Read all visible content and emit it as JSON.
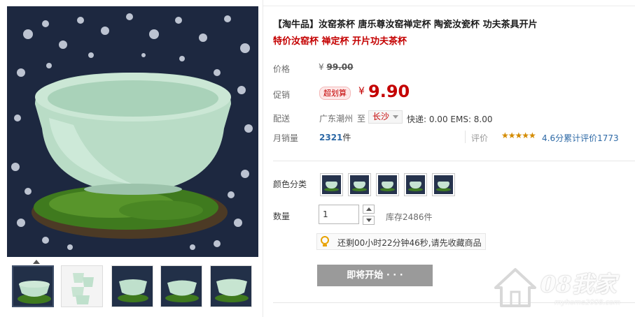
{
  "product": {
    "title": "【淘牛品】汝窑茶杯 唐乐尊汝窑禅定杯 陶瓷汝瓷杯 功夫茶具开片",
    "subtitle": "特价汝窑杯 禅定杯 开片功夫茶杯"
  },
  "price": {
    "label": "价格",
    "currency": "¥",
    "original": "99.00"
  },
  "promo": {
    "label": "促销",
    "badge": "超划算",
    "currency": "¥",
    "price": "9.90"
  },
  "shipping": {
    "label": "配送",
    "from": "广东潮州",
    "to_label": "至",
    "to_city": "长沙",
    "fees": "快递: 0.00 EMS: 8.00"
  },
  "sales": {
    "label": "月销量",
    "count": "2321",
    "unit": "件"
  },
  "rating": {
    "label": "评价",
    "stars": "★★★★★",
    "text": "4.6分累计评价1773"
  },
  "color": {
    "label": "颜色分类"
  },
  "quantity": {
    "label": "数量",
    "value": "1",
    "stock": "库存2486件"
  },
  "countdown": {
    "text": "还剩00小时22分钟46秒,请先收藏商品"
  },
  "button": {
    "label": "即将开始 · · ·"
  },
  "watermark": {
    "text": "08我家",
    "url": "myhome2008.com"
  },
  "colors": {
    "price_red": "#c40000",
    "link_blue": "#2d69a6",
    "button_gray": "#9a9a9a"
  },
  "icons": {
    "countdown_icon": "lightbulb-icon",
    "city_caret": "chevron-down-icon"
  }
}
